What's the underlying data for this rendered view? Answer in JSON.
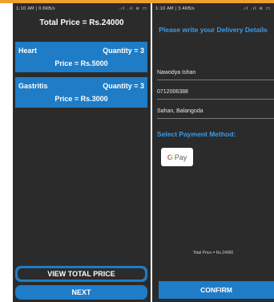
{
  "colors": {
    "accent": "#f0a030",
    "primary_blue": "#1f7cc6",
    "heading_blue": "#3c9be8",
    "phone_bg": "#2b2b2b"
  },
  "left": {
    "status": {
      "time": "1:10 AM | 0.6KB/s",
      "icons": ".ıl .ıl ≋ ▭"
    },
    "total_price": "Total Price = Rs.24000",
    "items": [
      {
        "name": "Heart",
        "quantity": "Quantity = 3",
        "price": "Price = Rs.5000"
      },
      {
        "name": "Gastritis",
        "quantity": "Quantity = 3",
        "price": "Price = Rs.3000"
      }
    ],
    "view_total_label": "VIEW TOTAL PRICE",
    "next_label": "NEXT"
  },
  "right": {
    "status": {
      "time": "1:10 AM | 3.4KB/s",
      "icons": ".ıl .ıl ≋ ▭"
    },
    "title": "Please write your Delivery Details",
    "name": "Nawodya Ishan",
    "phone": "0712006388",
    "address": "Sahan, Balangoda",
    "payment_label": "Select Payment Method:",
    "gpay": {
      "g": "G",
      "label": "Pay"
    },
    "total_note": "Total Price = Rs.24000",
    "confirm_label": "CONFIRM"
  }
}
